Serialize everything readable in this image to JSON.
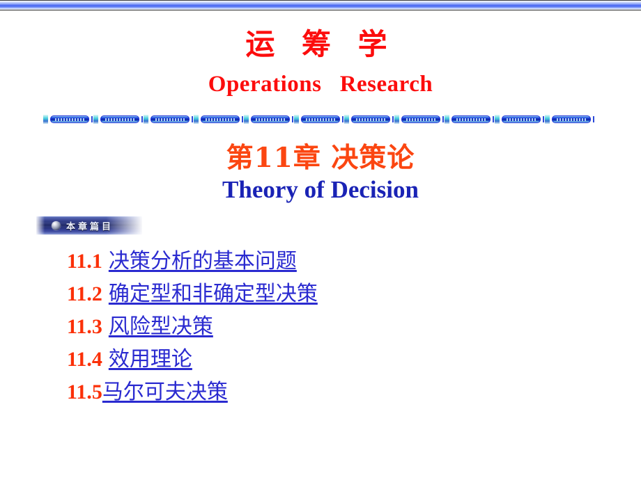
{
  "slide": {
    "top_bar": {
      "name": "decorative-top-band"
    },
    "title_cn": "运 筹 学",
    "title_en": "Operations   Research",
    "divider": {
      "name": "decorative-divider",
      "segments": 11
    },
    "chapter_cn": "第11章 决策论",
    "chapter_en": "Theory of Decision",
    "badge": {
      "icon": "sphere-bullet-icon",
      "label": "本章篇目"
    },
    "contents": [
      {
        "number": "11.1",
        "label": "决策分析的基本问题",
        "spaced": true
      },
      {
        "number": "11.2",
        "label": "确定型和非确定型决策",
        "spaced": true
      },
      {
        "number": "11.3",
        "label": "风险型决策",
        "spaced": true
      },
      {
        "number": "11.4",
        "label": "效用理论",
        "spaced": true
      },
      {
        "number": "11.5",
        "label": "马尔可夫决策",
        "spaced": false
      }
    ]
  },
  "colors": {
    "title_red": "#fc0d0d",
    "chapter_orange": "#fb4611",
    "chapter_blue": "#1a23b5",
    "link_blue": "#2a2ad0",
    "number_red": "#fb3008",
    "bar_blue": "#4466f2",
    "badge_navy": "#141f66",
    "background": "#ffffff"
  }
}
